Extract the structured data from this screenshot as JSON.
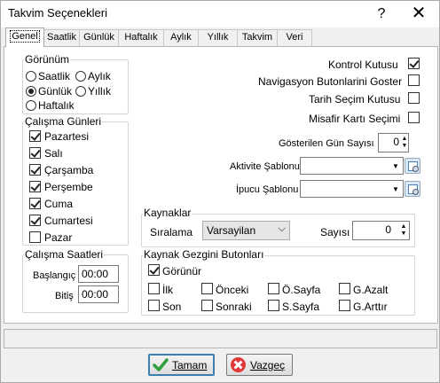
{
  "window": {
    "title": "Takvim Seçenekleri",
    "help": "?",
    "close": "✕"
  },
  "tabs": [
    "Genel",
    "Saatlik",
    "Günlük",
    "Haftalık",
    "Aylık",
    "Yıllık",
    "Takvim",
    "Veri"
  ],
  "view": {
    "title": "Görünüm",
    "options": [
      {
        "label": "Saatlik",
        "selected": false
      },
      {
        "label": "Aylık",
        "selected": false
      },
      {
        "label": "Günlük",
        "selected": true
      },
      {
        "label": "Yıllık",
        "selected": false
      },
      {
        "label": "Haftalık",
        "selected": false
      }
    ]
  },
  "workdays": {
    "title": "Çalışma Günleri",
    "days": [
      {
        "label": "Pazartesi",
        "checked": true
      },
      {
        "label": "Salı",
        "checked": true
      },
      {
        "label": "Çarşamba",
        "checked": true
      },
      {
        "label": "Perşembe",
        "checked": true
      },
      {
        "label": "Cuma",
        "checked": true
      },
      {
        "label": "Cumartesi",
        "checked": true
      },
      {
        "label": "Pazar",
        "checked": false
      }
    ]
  },
  "workhours": {
    "title": "Çalışma Saatleri",
    "start_label": "Başlangıç",
    "start_value": "00:00",
    "end_label": "Bitiş",
    "end_value": "00:00"
  },
  "options": {
    "control_box": {
      "label": "Kontrol Kutusu",
      "checked": true
    },
    "nav_buttons": {
      "label": "Navigasyon Butonlarini Goster",
      "checked": false
    },
    "date_picker": {
      "label": "Tarih Seçim Kutusu",
      "checked": false
    },
    "guest_card": {
      "label": "Misafir Kartı Seçimi",
      "checked": false
    },
    "shown_days": {
      "label": "Gösterilen Gün Sayısı",
      "value": "0"
    },
    "activity_template": {
      "label": "Aktivite Şablonu",
      "value": ""
    },
    "tooltip_template": {
      "label": "İpucu Şablonu",
      "value": ""
    }
  },
  "resources": {
    "title": "Kaynaklar",
    "sort_label": "Sıralama",
    "sort_value": "Varsayilan",
    "count_label": "Sayısı",
    "count_value": "0"
  },
  "nav": {
    "title": "Kaynak Gezgini Butonları",
    "visible": {
      "label": "Görünür",
      "checked": true
    },
    "buttons": [
      {
        "label": "İlk",
        "checked": false
      },
      {
        "label": "Önceki",
        "checked": false
      },
      {
        "label": "Ö.Sayfa",
        "checked": false
      },
      {
        "label": "G.Azalt",
        "checked": false
      },
      {
        "label": "Son",
        "checked": false
      },
      {
        "label": "Sonraki",
        "checked": false
      },
      {
        "label": "S.Sayfa",
        "checked": false
      },
      {
        "label": "G.Arttır",
        "checked": false
      }
    ]
  },
  "buttons": {
    "ok": "Tamam",
    "cancel": "Vazgeç"
  }
}
